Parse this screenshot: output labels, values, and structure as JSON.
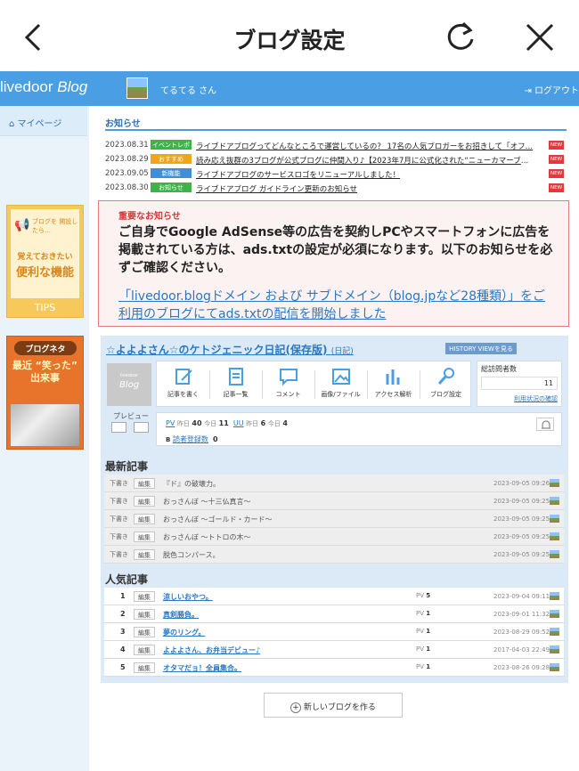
{
  "topbar": {
    "title": "ブログ設定",
    "back_icon": "chevron-left-icon",
    "reload_icon": "reload-icon",
    "close_icon": "close-icon"
  },
  "header": {
    "logo_prefix": "livedoor ",
    "logo_suffix": "Blog",
    "user": "てるてる さん",
    "logout": "ログアウト",
    "bg_color": "#4a9ee3"
  },
  "sidebar": {
    "mypage": "マイページ",
    "tips_small": "ブログを 開設したら…",
    "tips_mid": "覚えておきたい",
    "tips_big": "便利な機能",
    "tips_label": "TIPS",
    "neta_tag": "ブログネタ",
    "neta_text": "最近 “笑った” 出来事"
  },
  "notices": {
    "title": "お知らせ",
    "new_label": "NEW",
    "items": [
      {
        "date": "2023.08.31",
        "badge": "イベントレポ",
        "badge_color": "#3bb54a",
        "text": "ライブドアブログってどんなところで運営しているの？ 17名の人気ブロガーをお招きして「オフ…"
      },
      {
        "date": "2023.08.29",
        "badge": "おすすめ",
        "badge_color": "#f2a51a",
        "text": "読み応え抜群の3ブログが公式ブログに仲間入り♪【2023年7月に公式化された“ニューカマーブロ…"
      },
      {
        "date": "2023.09.05",
        "badge": "新機能",
        "badge_color": "#3d8fd9",
        "text": "ライブドアブログのサービスロゴをリニューアルしました！"
      },
      {
        "date": "2023.08.30",
        "badge": "お知らせ",
        "badge_color": "#3bb54a",
        "text": "ライブドアブログ ガイドライン更新のお知らせ"
      }
    ]
  },
  "alert": {
    "heading": "重要なお知らせ",
    "body": "ご自身でGoogle AdSense等の広告を契約しPCやスマートフォンに広告を掲載されている方は、ads.txtの設定が必須になります。以下のお知らせを必ずご確認ください。",
    "link": "「livedoor.blogドメイン および サブドメイン（blog.jpなど28種類）」をご利用のブログにてads.txtの配信を開始しました"
  },
  "blog": {
    "title": "☆よよよさん☆のケトジェニック日記(保存版)",
    "title_note": "(日記)",
    "history_button": "HISTORY VIEWを見る",
    "thumb_top": "livedoor",
    "thumb_label": "Blog",
    "preview": "プレビュー",
    "tools": [
      {
        "label": "記事を書く",
        "icon": "write-icon"
      },
      {
        "label": "記事一覧",
        "icon": "list-icon"
      },
      {
        "label": "コメント",
        "icon": "comment-icon"
      },
      {
        "label": "画像/ファイル",
        "icon": "image-icon"
      },
      {
        "label": "アクセス解析",
        "icon": "chart-icon"
      },
      {
        "label": "ブログ設定",
        "icon": "settings-icon"
      }
    ],
    "visitors_label": "総訪問者数",
    "visitors_value": "11",
    "usage_link": "利用状況の確認",
    "stats": {
      "pv_key": "PV",
      "yesterday_label": "昨日",
      "pv_yesterday": "40",
      "today_label": "今日",
      "pv_today": "11",
      "uu_key": "UU",
      "uu_yesterday": "6",
      "uu_today": "4",
      "reader_key": "読者登録数",
      "reader_count": "0"
    }
  },
  "latest": {
    "title": "最新記事",
    "draft_label": "下書き",
    "edit_label": "編集",
    "items": [
      {
        "name": "『ド』の破壊力。",
        "time": "2023-09-05 09:26"
      },
      {
        "name": "おっさんぼ 〜十三仏真言〜",
        "time": "2023-09-05 09:25"
      },
      {
        "name": "おっさんぼ 〜ゴールド・カード〜",
        "time": "2023-09-05 09:25"
      },
      {
        "name": "おっさんぼ 〜トトロの木〜",
        "time": "2023-09-05 09:25"
      },
      {
        "name": "脱色コンパース。",
        "time": "2023-09-05 09:25"
      }
    ]
  },
  "popular": {
    "title": "人気記事",
    "pv_label": "PV",
    "items": [
      {
        "rank": "1",
        "name": "涼しいおやつ。",
        "pv": "5",
        "time": "2023-09-04 09:11"
      },
      {
        "rank": "2",
        "name": "真剣勝負。",
        "pv": "1",
        "time": "2023-09-01 11:32"
      },
      {
        "rank": "3",
        "name": "夢のリング。",
        "pv": "1",
        "time": "2023-08-29 09:52"
      },
      {
        "rank": "4",
        "name": "よよよさん、お弁当デビュー♪",
        "pv": "1",
        "time": "2017-04-03 22:49"
      },
      {
        "rank": "5",
        "name": "オタマだョ！全員集合。",
        "pv": "1",
        "time": "2023-08-26 09:28"
      }
    ]
  },
  "new_blog_button": "新しいブログを作る"
}
